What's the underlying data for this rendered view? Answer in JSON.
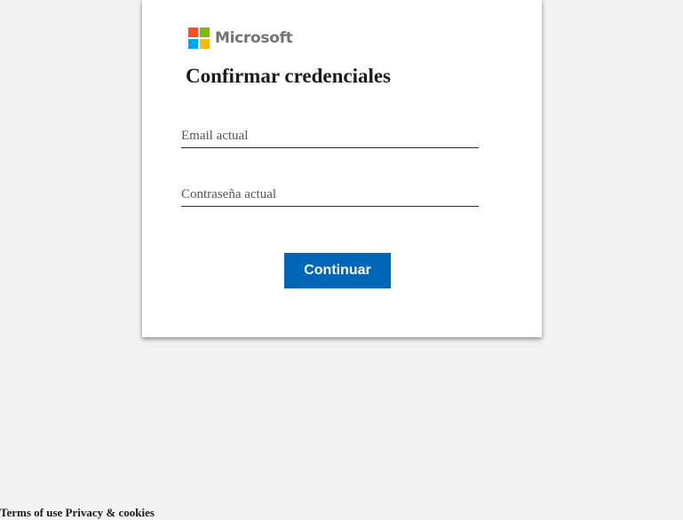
{
  "brand": {
    "name": "Microsoft",
    "colors": [
      "#f25022",
      "#7fba00",
      "#00a4ef",
      "#ffb900"
    ]
  },
  "form": {
    "title": "Confirmar credenciales",
    "email_placeholder": "Email actual",
    "password_placeholder": "Contraseña actual",
    "submit_label": "Continuar"
  },
  "footer": {
    "terms": "Terms of use",
    "privacy": "Privacy & cookies"
  },
  "theme": {
    "accent": "#0067b8",
    "background": "#f2f2f2"
  }
}
